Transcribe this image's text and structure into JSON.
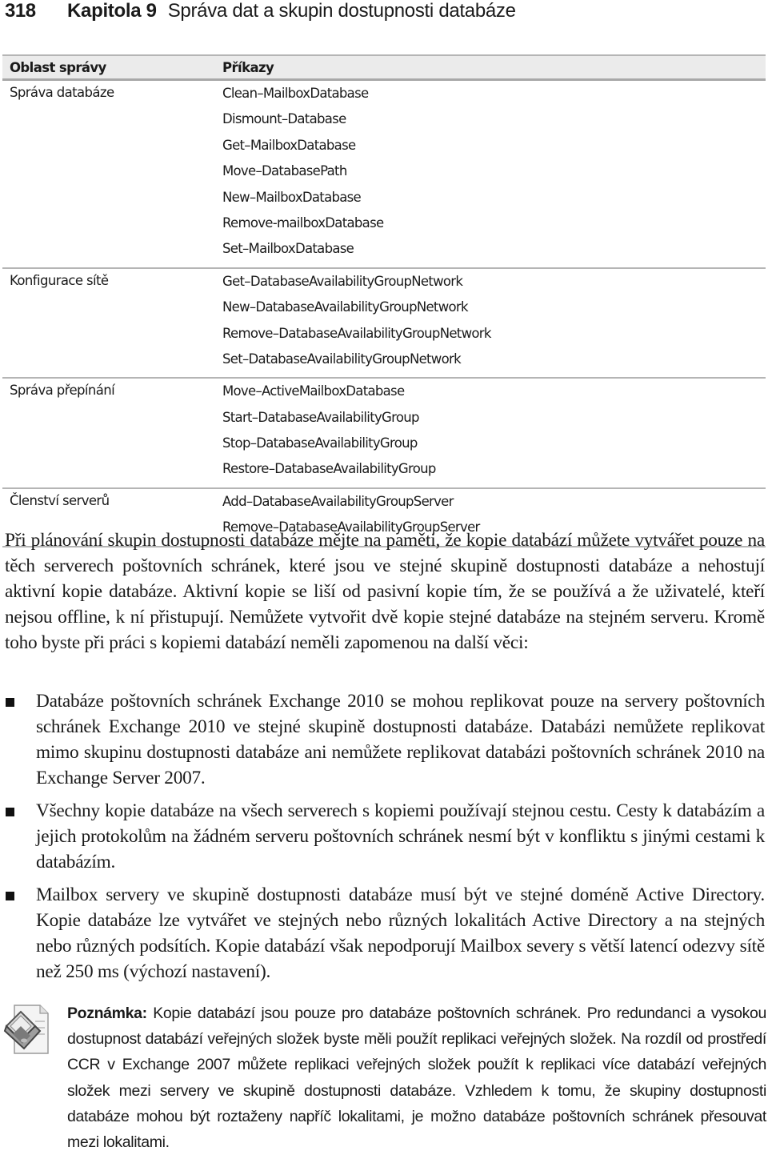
{
  "running_head": {
    "page_number": "318",
    "chapter": "Kapitola 9",
    "chapter_title": "Správa dat a skupin dostupnosti databáze"
  },
  "table": {
    "headers": [
      "Oblast správy",
      "Příkazy"
    ],
    "groups": [
      {
        "area": "Správa databáze",
        "commands": [
          "Clean–MailboxDatabase",
          "Dismount–Database",
          "Get–MailboxDatabase",
          "Move–DatabasePath",
          "New–MailboxDatabase",
          "Remove-mailboxDatabase",
          "Set–MailboxDatabase"
        ]
      },
      {
        "area": "Konfigurace sítě",
        "commands": [
          "Get–DatabaseAvailabilityGroupNetwork",
          "New–DatabaseAvailabilityGroupNetwork",
          "Remove–DatabaseAvailabilityGroupNetwork",
          "Set–DatabaseAvailabilityGroupNetwork"
        ]
      },
      {
        "area": "Správa přepínání",
        "commands": [
          "Move–ActiveMailboxDatabase",
          "Start–DatabaseAvailabilityGroup",
          "Stop–DatabaseAvailabilityGroup",
          "Restore–DatabaseAvailabilityGroup"
        ]
      },
      {
        "area": "Členství serverů",
        "commands": [
          "Add–DatabaseAvailabilityGroupServer",
          "Remove–DatabaseAvailabilityGroupServer"
        ]
      }
    ]
  },
  "intro_paragraph": "Při plánování skupin dostupnosti databáze mějte na paměti, že kopie databází můžete vytvářet pouze na těch serverech poštovních schránek, které jsou ve stejné skupině dostupnosti databáze a nehostují aktivní kopie databáze. Aktivní kopie se liší od pasivní kopie tím, že se používá a že uživatelé, kteří nejsou offline, k ní přistupují. Nemůžete vytvořit dvě kopie stejné databáze na stejném serveru. Kromě toho byste při práci s kopiemi databází neměli zapomenou na další věci:",
  "bullets": [
    "Databáze poštovních schránek Exchange 2010 se mohou replikovat pouze na servery poštovních schránek Exchange 2010 ve stejné skupině dostupnosti databáze. Databázi nemůžete replikovat mimo skupinu dostupnosti databáze ani nemůžete replikovat databázi poštovních schránek 2010 na Exchange Server 2007.",
    "Všechny kopie databáze na všech serverech s kopiemi používají stejnou cestu. Cesty k databázím a jejich protokolům na žádném serveru poštovních schránek nesmí být v konfliktu s jinými cestami k databázím.",
    "Mailbox servery ve skupině dostupnosti databáze musí být ve stejné doméně Active Directory. Kopie databáze lze vytvářet ve stejných nebo různých lokalitách Active Directory a na stejných nebo různých podsítích. Kopie databází však nepodporují Mailbox severy s větší latencí odezvy sítě než 250 ms (výchozí nastavení)."
  ],
  "note": {
    "icon": "note-laptop-icon",
    "label": "Poznámka:",
    "text": " Kopie databází jsou pouze pro databáze poštovních schránek. Pro redundanci a vysokou dostupnost databází veřejných složek byste měli použít replikaci veřejných složek. Na rozdíl od prostředí CCR v Exchange 2007 můžete replikaci veřejných složek použít k replikaci více databází veřejných složek mezi servery ve skupině dostupnosti databáze. Vzhledem k tomu, že skupiny dostupnosti databáze mohou být roztaženy napříč lokalitami, je možno databáze poštovních schránek přesouvat mezi lokalitami."
  }
}
